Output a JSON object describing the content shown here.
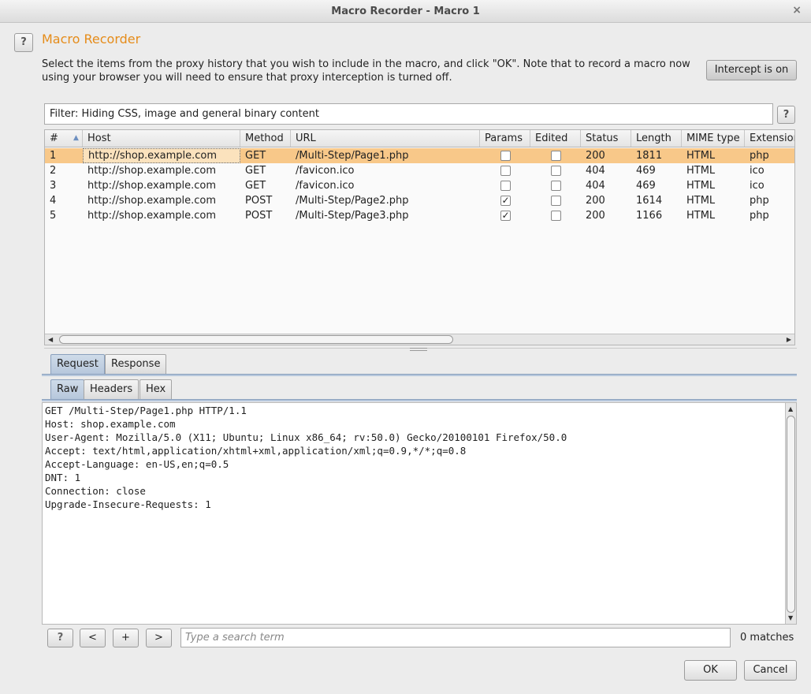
{
  "window": {
    "title": "Macro Recorder - Macro 1",
    "close_glyph": "×"
  },
  "header": {
    "help_label": "?",
    "heading": "Macro Recorder",
    "description": "Select the items from the proxy history that you wish to include in the macro, and click \"OK\". Note that to record a macro now using your browser you will need to ensure that proxy interception is turned off.",
    "intercept_label": "Intercept is on"
  },
  "filter": {
    "text": "Filter: Hiding CSS, image and general binary content",
    "help_label": "?"
  },
  "table": {
    "columns": [
      "#",
      "Host",
      "Method",
      "URL",
      "Params",
      "Edited",
      "Status",
      "Length",
      "MIME type",
      "Extension"
    ],
    "sort_indicator": "▲",
    "rows": [
      {
        "num": "1",
        "host": "http://shop.example.com",
        "method": "GET",
        "url": "/Multi-Step/Page1.php",
        "params": false,
        "edited": false,
        "status": "200",
        "length": "1811",
        "mime": "HTML",
        "ext": "php",
        "selected": true
      },
      {
        "num": "2",
        "host": "http://shop.example.com",
        "method": "GET",
        "url": "/favicon.ico",
        "params": false,
        "edited": false,
        "status": "404",
        "length": "469",
        "mime": "HTML",
        "ext": "ico",
        "selected": false
      },
      {
        "num": "3",
        "host": "http://shop.example.com",
        "method": "GET",
        "url": "/favicon.ico",
        "params": false,
        "edited": false,
        "status": "404",
        "length": "469",
        "mime": "HTML",
        "ext": "ico",
        "selected": false
      },
      {
        "num": "4",
        "host": "http://shop.example.com",
        "method": "POST",
        "url": "/Multi-Step/Page2.php",
        "params": true,
        "edited": false,
        "status": "200",
        "length": "1614",
        "mime": "HTML",
        "ext": "php",
        "selected": false
      },
      {
        "num": "5",
        "host": "http://shop.example.com",
        "method": "POST",
        "url": "/Multi-Step/Page3.php",
        "params": true,
        "edited": false,
        "status": "200",
        "length": "1166",
        "mime": "HTML",
        "ext": "php",
        "selected": false
      }
    ],
    "check_glyph": "✓"
  },
  "tabs": {
    "top": [
      "Request",
      "Response"
    ],
    "sub": [
      "Raw",
      "Headers",
      "Hex"
    ]
  },
  "request_raw": "GET /Multi-Step/Page1.php HTTP/1.1\nHost: shop.example.com\nUser-Agent: Mozilla/5.0 (X11; Ubuntu; Linux x86_64; rv:50.0) Gecko/20100101 Firefox/50.0\nAccept: text/html,application/xhtml+xml,application/xml;q=0.9,*/*;q=0.8\nAccept-Language: en-US,en;q=0.5\nDNT: 1\nConnection: close\nUpgrade-Insecure-Requests: 1",
  "search": {
    "help_label": "?",
    "prev_label": "<",
    "add_label": "+",
    "next_label": ">",
    "placeholder": "Type a search term",
    "matches": "0 matches"
  },
  "footer": {
    "ok_label": "OK",
    "cancel_label": "Cancel"
  }
}
